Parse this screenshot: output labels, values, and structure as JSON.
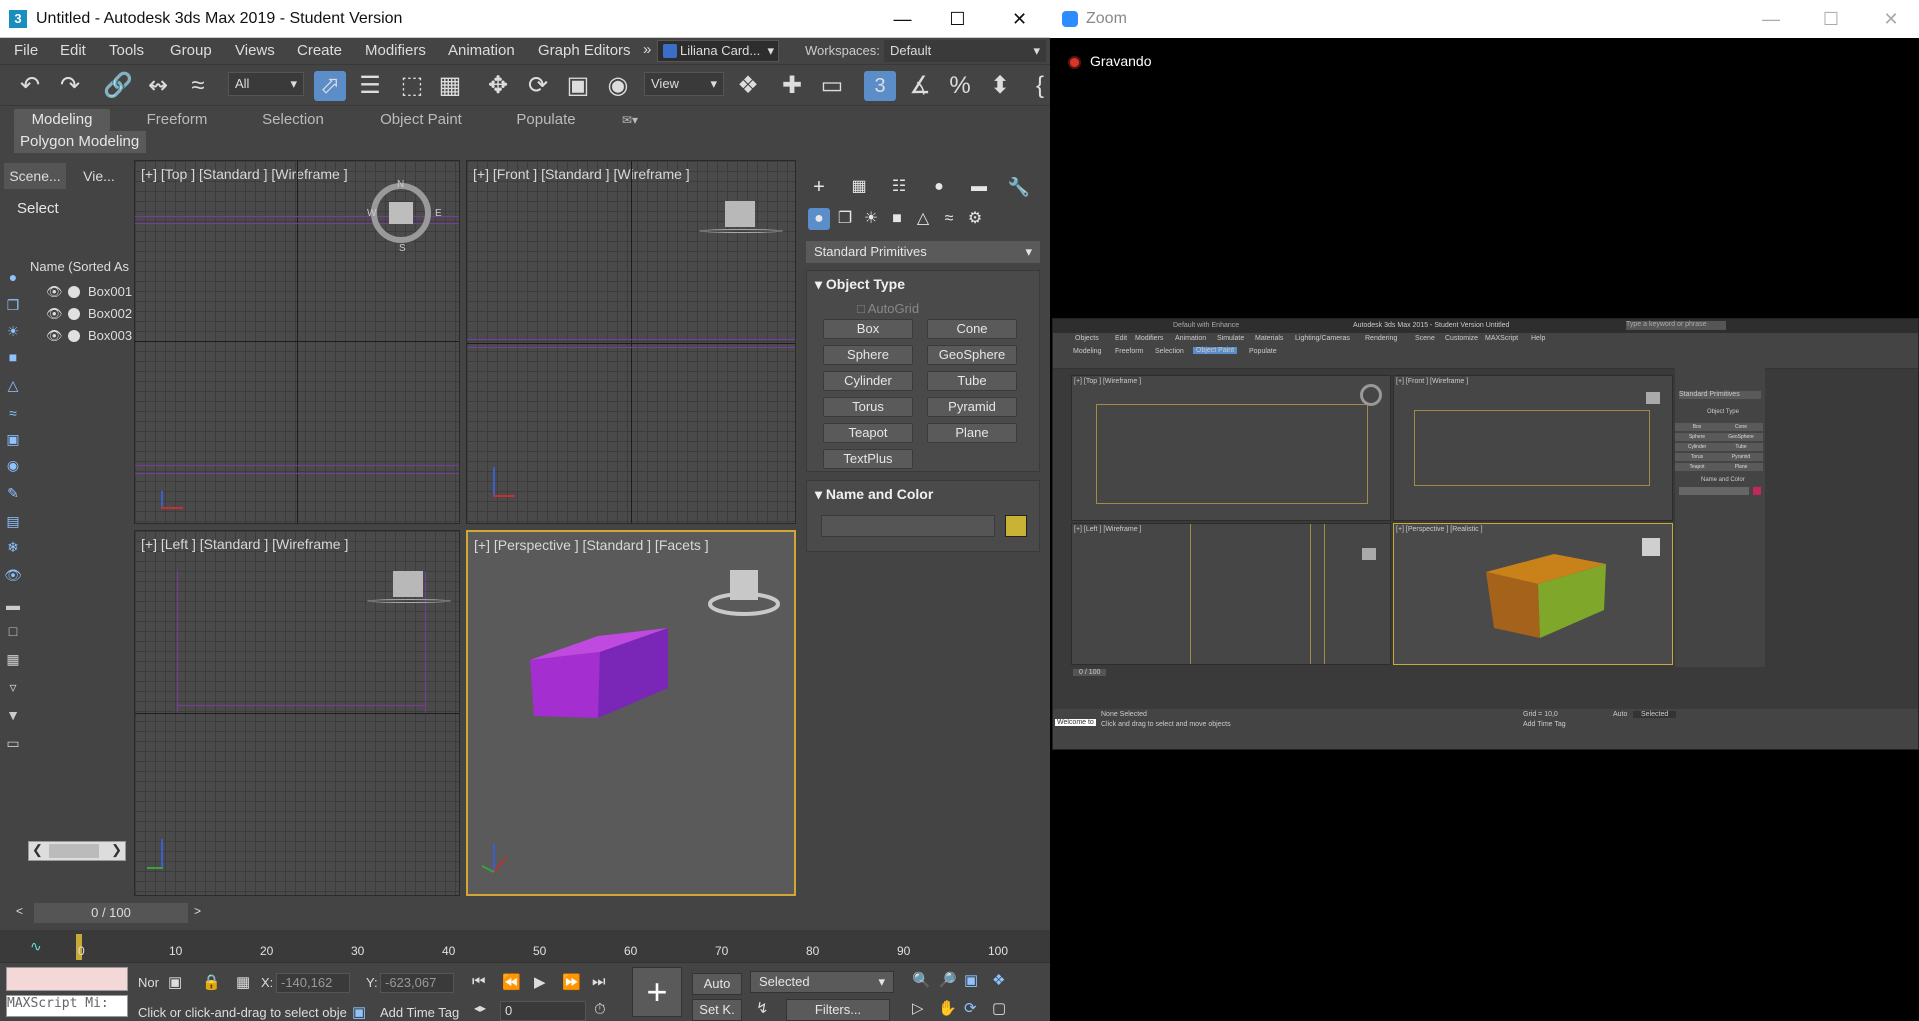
{
  "max_window": {
    "app_icon": "3",
    "title": "Untitled - Autodesk 3ds Max 2019 - Student Version",
    "menu": [
      "File",
      "Edit",
      "Tools",
      "Group",
      "Views",
      "Create",
      "Modifiers",
      "Animation",
      "Graph Editors"
    ],
    "menu_more": "»",
    "user": "Liliana Card...",
    "workspaces_label": "Workspaces:",
    "workspaces_value": "Default",
    "toolbar": {
      "selection_filter": "All",
      "ref_coord": "View",
      "snap_value": "3"
    },
    "ribbon_tabs": [
      "Modeling",
      "Freeform",
      "Selection",
      "Object Paint",
      "Populate"
    ],
    "ribbon_active": "Modeling",
    "polygon_modeling": "Polygon Modeling",
    "scene_explorer": {
      "tab_scene": "Scene...",
      "tab_view": "Vie...",
      "select_label": "Select",
      "column_header": "Name (Sorted As",
      "objects": [
        "Box001",
        "Box002",
        "Box003"
      ]
    },
    "viewports": {
      "top": "[+] [Top ] [Standard ] [Wireframe ]",
      "front": "[+] [Front ] [Standard ] [Wireframe ]",
      "left": "[+] [Left ] [Standard ] [Wireframe ]",
      "perspective": "[+] [Perspective ] [Standard ] [Facets ]",
      "compass": {
        "n": "N",
        "w": "W",
        "e": "E",
        "s": "S"
      }
    },
    "command_panel": {
      "category": "Standard Primitives",
      "object_type_title": "Object Type",
      "autogrid": "AutoGrid",
      "primitives": [
        "Box",
        "Cone",
        "Sphere",
        "GeoSphere",
        "Cylinder",
        "Tube",
        "Torus",
        "Pyramid",
        "Teapot",
        "Plane",
        "TextPlus"
      ],
      "name_color_title": "Name and Color",
      "object_color": "#c9b337"
    },
    "time_slider": "0 / 100",
    "timeline_ticks": [
      "0",
      "10",
      "20",
      "30",
      "40",
      "50",
      "60",
      "70",
      "80",
      "90",
      "100"
    ],
    "status": {
      "maxscript": "MAXScript Mi:",
      "mode_prefix": "Nor",
      "x_label": "X:",
      "x_value": "-140,162",
      "y_label": "Y:",
      "y_value": "-623,067",
      "prompt": "Click or click-and-drag to select obje",
      "add_time_tag": "Add Time Tag",
      "auto": "Auto",
      "set_key": "Set K.",
      "selected": "Selected",
      "filters": "Filters...",
      "frame": "0"
    },
    "colors": {
      "box": "#9b2cc9",
      "accent": "#5b8dc9",
      "viewport_border": "#d2a733"
    }
  },
  "zoom_window": {
    "title": "Zoom",
    "recording": "Gravando",
    "shared_screen": {
      "title": "Autodesk 3ds Max 2015 - Student Version    Untitled",
      "search_placeholder": "Type a keyword or phrase",
      "workspace": "Default with Enhance",
      "menu": [
        "Objects",
        "Edit",
        "Modifiers",
        "Animation",
        "Simulate",
        "Materials",
        "Lighting/Cameras",
        "Rendering",
        "Scene",
        "Customize",
        "MAXScript",
        "Help"
      ],
      "tabs": [
        "Modeling",
        "Freeform",
        "Selection",
        "Object Paint",
        "Populate"
      ],
      "vp_top": "[+] [Top ] [Wireframe ]",
      "vp_front": "[+] [Front ] [Wireframe ]",
      "vp_left": "[+] [Left ] [Wireframe ]",
      "vp_persp": "[+] [Perspective ] [Realistic ]",
      "panel_dropdown": "Standard Primitives",
      "panel_title": "Object Type",
      "panel_name_color": "Name and Color",
      "primitives": [
        "Box",
        "Cone",
        "Sphere",
        "GeoSphere",
        "Cylinder",
        "Tube",
        "Torus",
        "Pyramid",
        "Teapot",
        "Plane"
      ],
      "frame_counter": "0 / 100",
      "status_none": "None Selected",
      "status_prompt": "Click and drag to select and move objects",
      "welcome": "Welcome to",
      "grid": "Grid = 10,0",
      "auto": "Auto",
      "selected": "Selected",
      "add_time_tag": "Add Time Tag",
      "box_color": "#c9821a"
    }
  }
}
